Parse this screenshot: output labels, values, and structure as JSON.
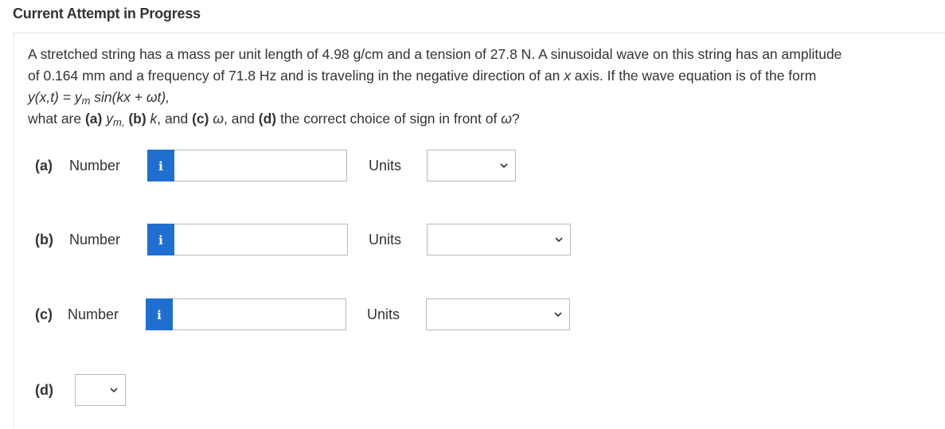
{
  "header": {
    "title": "Current Attempt in Progress"
  },
  "question": {
    "line1": "A stretched string has a mass per unit length of 4.98 g/cm and a tension of 27.8 N. A sinusoidal wave on this string has an amplitude",
    "line2_a": "of 0.164 mm and a frequency of 71.8 Hz and is traveling in the negative direction of an ",
    "line2_x": "x",
    "line2_b": " axis. If the wave equation is of the form",
    "equation_lhs": "y(x,t) = y",
    "equation_sub": "m",
    "equation_rhs": " sin(kx + ωt),",
    "ask_1": "what are ",
    "ask_a": "(a)",
    "ask_ym": " y",
    "ask_ym_sub": "m,",
    "ask_b": " (b)",
    "ask_k": " k",
    "ask_2": ", and ",
    "ask_c": "(c)",
    "ask_w": " ω",
    "ask_3": ", and ",
    "ask_d": "(d)",
    "ask_4": " the correct choice of sign in front of ",
    "ask_w2": "ω",
    "ask_5": "?"
  },
  "answers": {
    "a": {
      "part": "(a)",
      "number_label": "Number",
      "info_glyph": "i",
      "value": "",
      "units_label": "Units",
      "units_selected": ""
    },
    "b": {
      "part": "(b)",
      "number_label": "Number",
      "info_glyph": "i",
      "value": "",
      "units_label": "Units",
      "units_selected": ""
    },
    "c": {
      "part": "(c)",
      "number_label": "Number",
      "info_glyph": "i",
      "value": "",
      "units_label": "Units",
      "units_selected": ""
    },
    "d": {
      "part": "(d)",
      "sign_selected": ""
    }
  },
  "colors": {
    "info_button": "#1f6fd1",
    "border": "#b9b9b9",
    "text": "#333333"
  },
  "icons": {
    "info": "info-icon",
    "dropdown": "chevron-down-icon"
  }
}
